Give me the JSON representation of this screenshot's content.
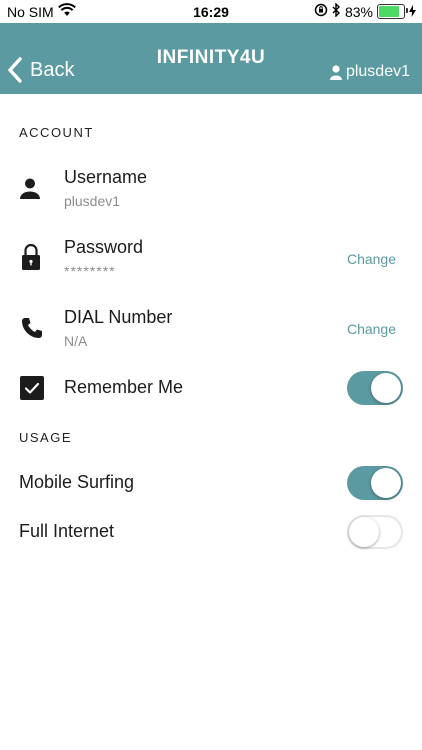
{
  "status_bar": {
    "carrier": "No SIM",
    "time": "16:29",
    "battery": "83%",
    "battery_level": 0.83
  },
  "nav": {
    "back_label": "Back",
    "title": "INFINITY4U",
    "user": "plusdev1"
  },
  "account": {
    "header": "ACCOUNT",
    "username": {
      "title": "Username",
      "value": "plusdev1"
    },
    "password": {
      "title": "Password",
      "value": "********",
      "action": "Change"
    },
    "dial": {
      "title": "DIAL Number",
      "value": "N/A",
      "action": "Change"
    },
    "remember": {
      "title": "Remember Me",
      "checked": true,
      "toggle_on": true
    }
  },
  "usage": {
    "header": "USAGE",
    "mobile_surfing": {
      "title": "Mobile Surfing",
      "toggle_on": true
    },
    "full_internet": {
      "title": "Full Internet",
      "toggle_on": false
    }
  },
  "colors": {
    "accent": "#5a9aa0",
    "text": "#1c1c1c",
    "muted": "#8c8c8c"
  }
}
